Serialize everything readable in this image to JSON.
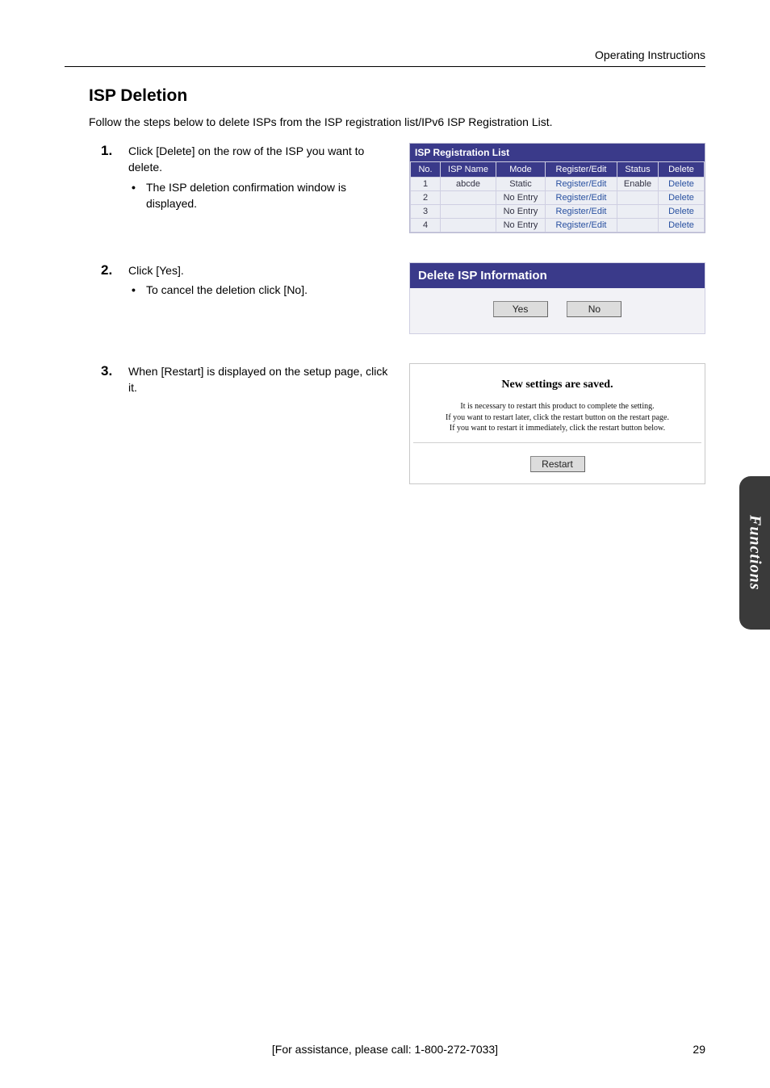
{
  "header": {
    "right": "Operating Instructions"
  },
  "section": {
    "title": "ISP Deletion",
    "intro": "Follow the steps below to delete ISPs from the ISP registration list/IPv6 ISP Registration List."
  },
  "step1": {
    "num": "1.",
    "text": "Click [Delete] on the row of the ISP you want to delete.",
    "bullet": "The ISP deletion confirmation window is displayed."
  },
  "step2": {
    "num": "2.",
    "text": "Click [Yes].",
    "bullet": "To cancel the deletion click [No]."
  },
  "step3": {
    "num": "3.",
    "text": "When [Restart] is displayed on the setup page, click it."
  },
  "isp_panel": {
    "title": "ISP Registration List",
    "headers": {
      "no": "No.",
      "name": "ISP Name",
      "mode": "Mode",
      "reg": "Register/Edit",
      "status": "Status",
      "delete": "Delete"
    },
    "rows": [
      {
        "no": "1",
        "name": "abcde",
        "mode": "Static",
        "reg": "Register/Edit",
        "status": "Enable",
        "del": "Delete"
      },
      {
        "no": "2",
        "name": "",
        "mode": "No Entry",
        "reg": "Register/Edit",
        "status": "",
        "del": "Delete"
      },
      {
        "no": "3",
        "name": "",
        "mode": "No Entry",
        "reg": "Register/Edit",
        "status": "",
        "del": "Delete"
      },
      {
        "no": "4",
        "name": "",
        "mode": "No Entry",
        "reg": "Register/Edit",
        "status": "",
        "del": "Delete"
      }
    ]
  },
  "delete_panel": {
    "title": "Delete ISP Information",
    "yes": "Yes",
    "no": "No"
  },
  "restart_panel": {
    "saved": "New settings are saved.",
    "line1": "It is necessary to restart this product to complete the setting.",
    "line2": "If you want to restart later, click the restart button on the restart page.",
    "line3": "If you want to restart it immediately, click the restart button below.",
    "button": "Restart"
  },
  "side_tab": "Functions",
  "footer": {
    "center": "[For assistance, please call: 1-800-272-7033]",
    "page": "29"
  }
}
